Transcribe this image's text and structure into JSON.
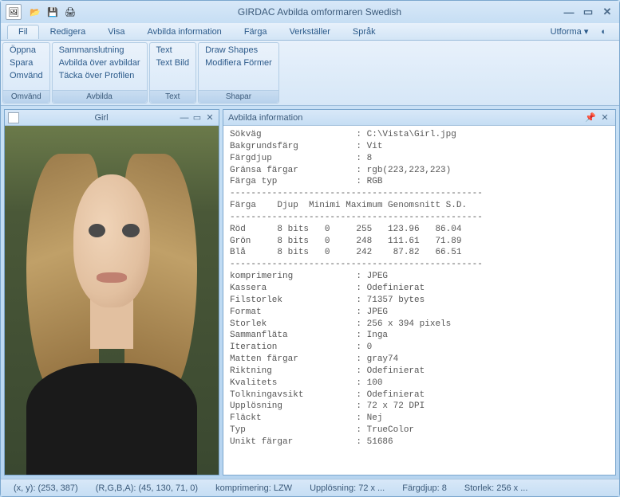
{
  "titlebar": {
    "app_title": "GIRDAC Avbilda omformaren Swedish"
  },
  "menu": {
    "items": [
      "Fil",
      "Redigera",
      "Visa",
      "Avbilda information",
      "Färga",
      "Verkställer",
      "Språk"
    ],
    "right": "Utforma",
    "active_index": 0
  },
  "ribbon": {
    "groups": [
      {
        "title": "Omvänd",
        "items": [
          "Öppna",
          "Spara",
          "Omvänd"
        ]
      },
      {
        "title": "Avbilda",
        "items": [
          "Sammanslutning",
          "Avbilda över avbildar",
          "Täcka över Profilen"
        ]
      },
      {
        "title": "Text",
        "items": [
          "Text",
          "Text Bild"
        ]
      },
      {
        "title": "Shapar",
        "items": [
          "Draw Shapes",
          "Modifiera Förmer"
        ]
      }
    ]
  },
  "sub_window": {
    "title": "Girl"
  },
  "info": {
    "title": "Avbilda information",
    "rows": [
      [
        "Sökväg",
        "C:\\Vista\\Girl.jpg"
      ],
      [
        "Bakgrundsfärg",
        "Vit"
      ],
      [
        "Färgdjup",
        "8"
      ],
      [
        "Gränsa färgar",
        "rgb(223,223,223)"
      ],
      [
        "Färga typ",
        "RGB"
      ]
    ],
    "channel_header": [
      "Färga",
      "Djup",
      "Minimi",
      "Maximum",
      "Genomsnitt",
      "S.D."
    ],
    "channels": [
      [
        "Röd",
        "8 bits",
        "0",
        "255",
        "123.96",
        "86.04"
      ],
      [
        "Grön",
        "8 bits",
        "0",
        "248",
        "111.61",
        "71.89"
      ],
      [
        "Blå",
        "8 bits",
        "0",
        "242",
        "87.82",
        "66.51"
      ]
    ],
    "rows2": [
      [
        "komprimering",
        "JPEG"
      ],
      [
        "Kassera",
        "Odefinierat"
      ],
      [
        "Filstorlek",
        "71357 bytes"
      ],
      [
        "Format",
        "JPEG"
      ],
      [
        "Storlek",
        "256 x 394 pixels"
      ],
      [
        "Sammanfläta",
        "Inga"
      ],
      [
        "Iteration",
        "0"
      ],
      [
        "Matten färgar",
        "gray74"
      ],
      [
        "Riktning",
        "Odefinierat"
      ],
      [
        "Kvalitets",
        "100"
      ],
      [
        "Tolkningavsikt",
        "Odefinierat"
      ],
      [
        "Upplösning",
        "72 x 72 DPI"
      ],
      [
        "Fläckt",
        "Nej"
      ],
      [
        "Typ",
        "TrueColor"
      ],
      [
        "Unikt färgar",
        "51686"
      ]
    ]
  },
  "status": {
    "xy": "(x, y): (253, 387)",
    "rgba": "(R,G,B,A): (45, 130, 71, 0)",
    "compression": "komprimering: LZW",
    "resolution": "Upplösning: 72 x ...",
    "depth": "Färgdjup: 8",
    "size": "Storlek: 256 x ..."
  }
}
